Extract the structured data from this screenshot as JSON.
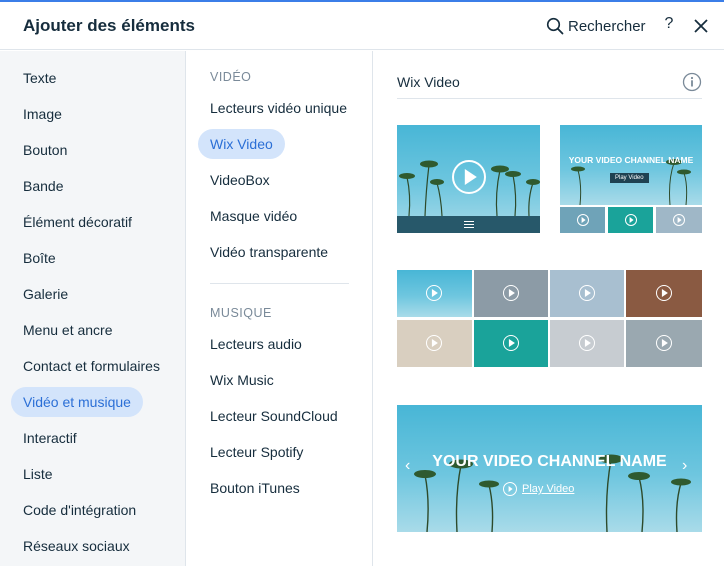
{
  "header": {
    "title": "Ajouter des éléments",
    "search_label": "Rechercher",
    "help_label": "?"
  },
  "categories": [
    {
      "label": "Texte",
      "active": false
    },
    {
      "label": "Image",
      "active": false
    },
    {
      "label": "Bouton",
      "active": false
    },
    {
      "label": "Bande",
      "active": false
    },
    {
      "label": "Élément décoratif",
      "active": false
    },
    {
      "label": "Boîte",
      "active": false
    },
    {
      "label": "Galerie",
      "active": false
    },
    {
      "label": "Menu et ancre",
      "active": false
    },
    {
      "label": "Contact et formulaires",
      "active": false
    },
    {
      "label": "Vidéo et musique",
      "active": true
    },
    {
      "label": "Interactif",
      "active": false
    },
    {
      "label": "Liste",
      "active": false
    },
    {
      "label": "Code d'intégration",
      "active": false
    },
    {
      "label": "Réseaux sociaux",
      "active": false
    }
  ],
  "subcategories": {
    "video_section": "VIDÉO",
    "video_items": [
      {
        "label": "Lecteurs vidéo unique",
        "active": false
      },
      {
        "label": "Wix Video",
        "active": true
      },
      {
        "label": "VideoBox",
        "active": false
      },
      {
        "label": "Masque vidéo",
        "active": false
      },
      {
        "label": "Vidéo transparente",
        "active": false
      }
    ],
    "music_section": "MUSIQUE",
    "music_items": [
      {
        "label": "Lecteurs audio",
        "active": false
      },
      {
        "label": "Wix Music",
        "active": false
      },
      {
        "label": "Lecteur SoundCloud",
        "active": false
      },
      {
        "label": "Lecteur Spotify",
        "active": false
      },
      {
        "label": "Bouton iTunes",
        "active": false
      }
    ]
  },
  "preview": {
    "heading": "Wix Video",
    "channel_name_small": "YOUR VIDEO CHANNEL NAME",
    "play_video_small": "Play Video",
    "channel_name_large": "YOUR VIDEO CHANNEL NAME",
    "play_video_large": "Play Video"
  },
  "colors": {
    "accent": "#3b7ee8",
    "active_bg": "#d3e4fb",
    "active_text": "#2b6fd6",
    "sidebar_bg": "#f4f6f8",
    "sky": "#48b6d6",
    "teal_tile": "#1aa39a"
  },
  "icons": [
    "search-icon",
    "help-icon",
    "close-icon",
    "info-icon",
    "play-icon",
    "menu-icon",
    "arrow-left-icon",
    "arrow-right-icon"
  ]
}
